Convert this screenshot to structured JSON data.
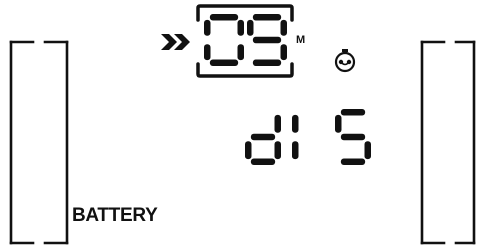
{
  "display": {
    "counter_value": "09",
    "counter_unit": "M",
    "status_text": "dI 5",
    "battery_label": "BATTERY"
  },
  "icons": {
    "arrow": "double-chevron-right-icon",
    "timer": "timer-dial-icon"
  },
  "colors": {
    "segment": "#111111",
    "background": "#ffffff"
  }
}
